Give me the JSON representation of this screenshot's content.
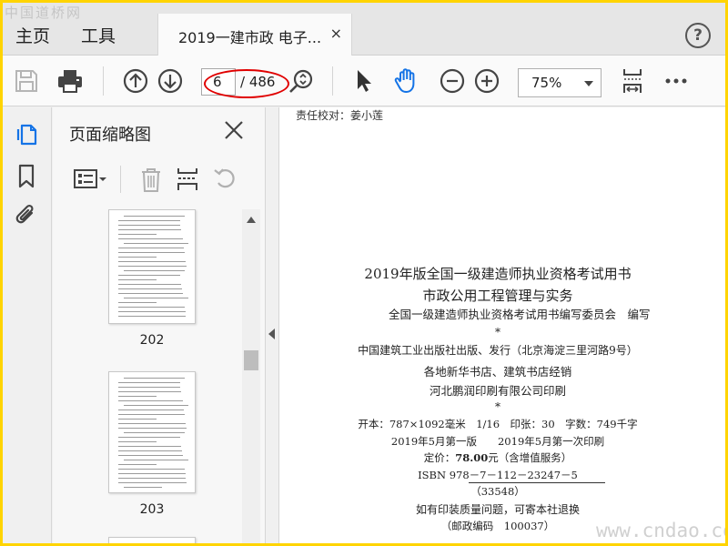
{
  "watermark_top": "中国道桥网",
  "menu": {
    "home": "主页",
    "tools": "工具"
  },
  "tab": {
    "title": "2019一建市政 电子...",
    "close": "×"
  },
  "help": "?",
  "toolbar": {
    "page_current": "6",
    "page_total": "/ 486",
    "zoom": "75%"
  },
  "panel": {
    "title": "页面缩略图"
  },
  "thumbnails": [
    {
      "page": "202"
    },
    {
      "page": "203"
    }
  ],
  "doc": {
    "proofreader": "责任校对：姜小莲",
    "title_line1": "2019年版全国一级建造师执业资格考试用书",
    "title_line2": "市政公用工程管理与实务",
    "editor": "全国一级建造师执业资格考试用书编写委员会　编写",
    "star1": "*",
    "publisher": "中国建筑工业出版社出版、发行（北京海淀三里河路9号）",
    "distributor": "各地新华书店、建筑书店经销",
    "printer": "河北鹏润印刷有限公司印刷",
    "star2": "*",
    "specs": "开本：787×1092毫米　1/16　印张：30　字数：749千字",
    "edition": "2019年5月第一版　　2019年5月第一次印刷",
    "price_label": "定价：",
    "price_value": "78.00",
    "price_suffix": "元（含增值服务）",
    "isbn": "ISBN 978－7－112－23247－5",
    "code": "（33548）",
    "notice": "如有印装质量问题，可寄本社退换",
    "postcode": "（邮政编码　100037）"
  },
  "watermark_bottom": "www.cndao.com",
  "colors": {
    "accent_blue": "#1473e6",
    "highlight_red": "#e00000",
    "frame_yellow": "#ffd400"
  }
}
